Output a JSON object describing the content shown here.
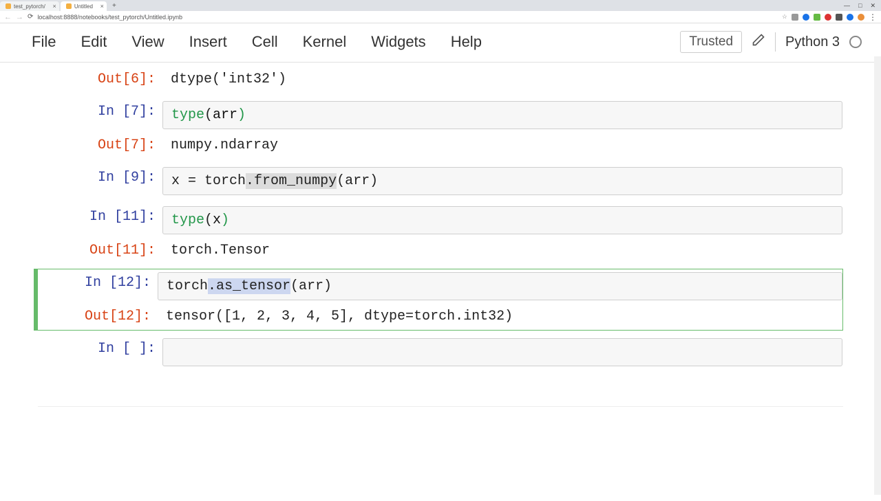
{
  "browser": {
    "tabs": [
      {
        "title": "test_pytorch/",
        "active": false
      },
      {
        "title": "Untitled",
        "active": true
      }
    ],
    "url": "localhost:8888/notebooks/test_pytorch/Untitled.ipynb"
  },
  "menubar": {
    "items": [
      "File",
      "Edit",
      "View",
      "Insert",
      "Cell",
      "Kernel",
      "Widgets",
      "Help"
    ],
    "trusted": "Trusted",
    "kernel_name": "Python 3",
    "edit_icon": "pencil-icon",
    "kernel_status": "idle"
  },
  "cells": [
    {
      "in_prompt": "",
      "out_prompt": "Out[6]:",
      "input_tokens": [],
      "output": "dtype('int32')",
      "has_input_visible": false,
      "selected": false
    },
    {
      "in_prompt": "In [7]:",
      "out_prompt": "Out[7]:",
      "input_tokens": [
        {
          "t": "type",
          "cls": "tok-builtin"
        },
        {
          "t": "(",
          "cls": ""
        },
        {
          "t": "arr",
          "cls": "tok-var"
        },
        {
          "t": ")",
          "cls": "tok-builtin"
        }
      ],
      "output": "numpy.ndarray",
      "has_input_visible": true,
      "selected": false
    },
    {
      "in_prompt": "In [9]:",
      "out_prompt": "",
      "input_tokens": [
        {
          "t": "x ",
          "cls": ""
        },
        {
          "t": "= ",
          "cls": ""
        },
        {
          "t": "torch",
          "cls": ""
        },
        {
          "t": ".from_numpy",
          "cls": "hl"
        },
        {
          "t": "(arr)",
          "cls": ""
        }
      ],
      "output": "",
      "has_input_visible": true,
      "selected": false
    },
    {
      "in_prompt": "In [11]:",
      "out_prompt": "Out[11]:",
      "input_tokens": [
        {
          "t": "type",
          "cls": "tok-builtin"
        },
        {
          "t": "(",
          "cls": ""
        },
        {
          "t": "x",
          "cls": "tok-var"
        },
        {
          "t": ")",
          "cls": "tok-builtin"
        }
      ],
      "output": "torch.Tensor",
      "has_input_visible": true,
      "selected": false
    },
    {
      "in_prompt": "In [12]:",
      "out_prompt": "Out[12]:",
      "input_tokens": [
        {
          "t": "torch",
          "cls": ""
        },
        {
          "t": ".as_tensor",
          "cls": "hl-sel"
        },
        {
          "t": "(arr)",
          "cls": ""
        }
      ],
      "output": "tensor([1, 2, 3, 4, 5], dtype=torch.int32)",
      "has_input_visible": true,
      "selected": true
    },
    {
      "in_prompt": "In [ ]:",
      "out_prompt": "",
      "input_tokens": [],
      "output": "",
      "has_input_visible": true,
      "selected": false
    }
  ]
}
